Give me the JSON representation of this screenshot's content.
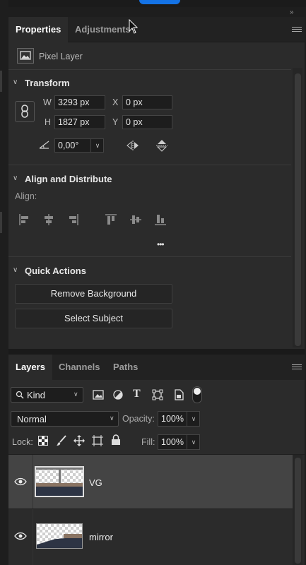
{
  "properties_panel": {
    "tabs": [
      {
        "label": "Properties",
        "active": true
      },
      {
        "label": "Adjustments",
        "active": false
      }
    ],
    "layer_kind": "Pixel Layer",
    "transform": {
      "title": "Transform",
      "w_label": "W",
      "w_value": "3293 px",
      "h_label": "H",
      "h_value": "1827 px",
      "x_label": "X",
      "x_value": "0 px",
      "y_label": "Y",
      "y_value": "0 px",
      "angle_value": "0,00°"
    },
    "align": {
      "title": "Align and Distribute",
      "label": "Align:",
      "more": "•••"
    },
    "quick_actions": {
      "title": "Quick Actions",
      "remove_bg": "Remove Background",
      "select_subject": "Select Subject"
    }
  },
  "layers_panel": {
    "tabs": [
      {
        "label": "Layers",
        "active": true
      },
      {
        "label": "Channels",
        "active": false
      },
      {
        "label": "Paths",
        "active": false
      }
    ],
    "filter": {
      "kind_label": "Kind"
    },
    "blend_mode": "Normal",
    "opacity_label": "Opacity:",
    "opacity_value": "100%",
    "lock_label": "Lock:",
    "fill_label": "Fill:",
    "fill_value": "100%",
    "layers": [
      {
        "name": "VG",
        "selected": true,
        "visible": true
      },
      {
        "name": "mirror",
        "selected": false,
        "visible": true
      }
    ]
  }
}
